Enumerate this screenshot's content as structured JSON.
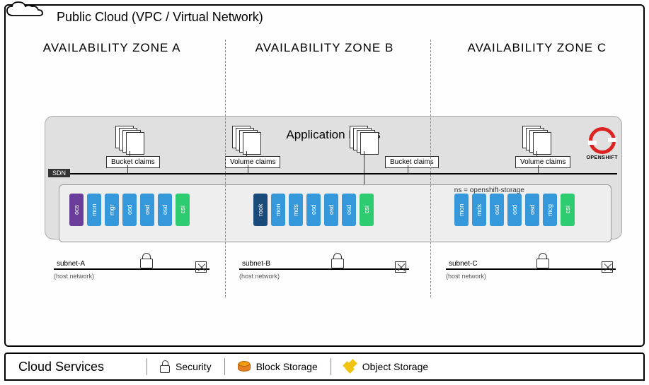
{
  "title": "Public Cloud (VPC / Virtual Network)",
  "zones": {
    "a": "AVAILABILITY ZONE A",
    "b": "AVAILABILITY ZONE B",
    "c": "AVAILABILITY ZONE C"
  },
  "appPodsTitle": "Application PODs",
  "openshiftLabel": "OPENSHIFT",
  "claims": {
    "a": "Bucket claims",
    "b1": "Volume claims",
    "b2": "Bucket claims",
    "c": "Volume claims"
  },
  "sdn": "SDN",
  "nsLabel": "ns = openshift-storage",
  "podsA": [
    "ocs",
    "mon",
    "mgr",
    "osd",
    "osd",
    "osd",
    "csi"
  ],
  "podsB": [
    "rook",
    "mon",
    "mds",
    "osd",
    "osd",
    "osd",
    "csi"
  ],
  "podsC": [
    "mon",
    "mds",
    "osd",
    "osd",
    "osd",
    "mcg",
    "csi"
  ],
  "subnets": {
    "a": "subnet-A",
    "b": "subnet-B",
    "c": "subnet-C"
  },
  "hostNetwork": "(host network)",
  "footer": {
    "services": "Cloud Services",
    "security": "Security",
    "block": "Block Storage",
    "object": "Object Storage"
  }
}
